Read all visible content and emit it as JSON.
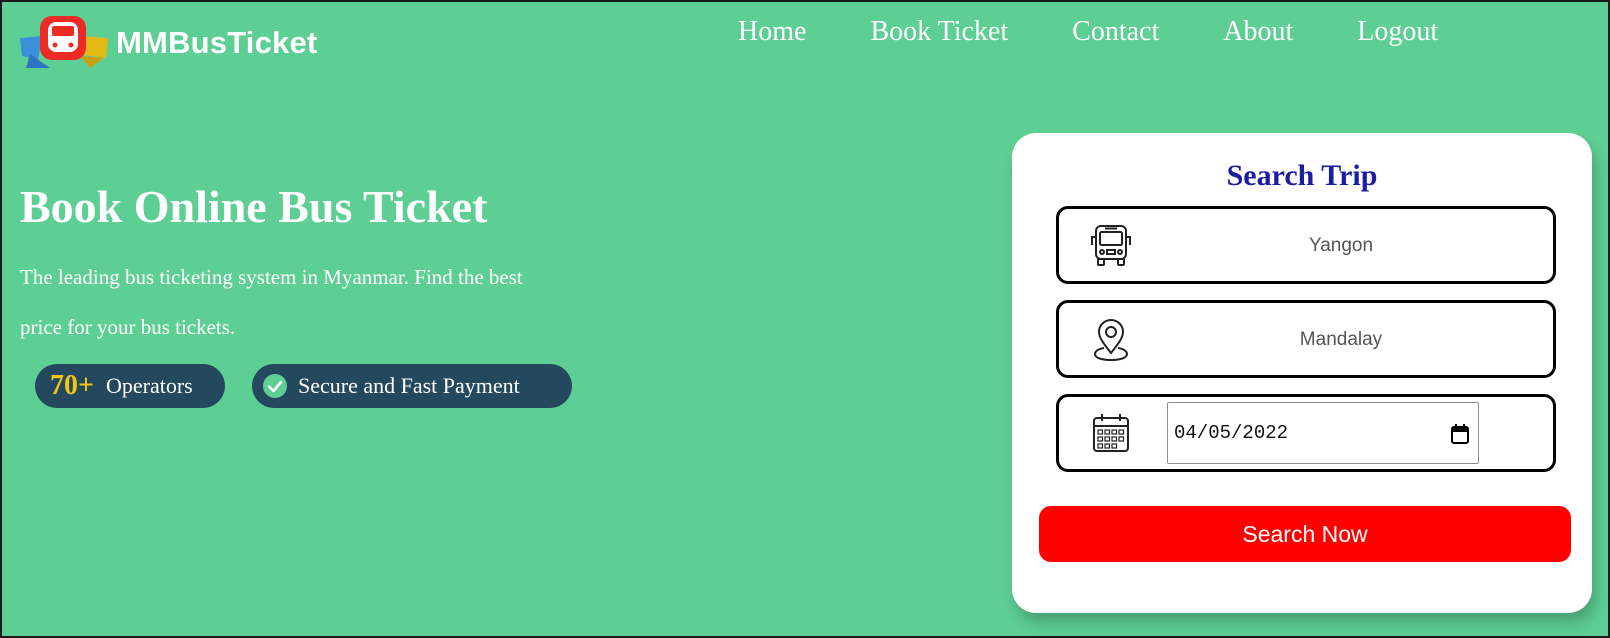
{
  "brand": {
    "name": "MMBusTicket",
    "logo_icon": "bus-logo-icon",
    "logo_color": "#ee2a24"
  },
  "nav": {
    "items": [
      "Home",
      "Book Ticket",
      "Contact",
      "About",
      "Logout"
    ]
  },
  "hero": {
    "title": "Book Online Bus Ticket",
    "description": "The leading bus ticketing system in Myanmar. Find the best price for your bus tickets.",
    "badges": {
      "operators_count": "70+",
      "operators_label": "Operators",
      "payment_label": "Secure and Fast Payment",
      "payment_icon": "check-circle-icon"
    }
  },
  "search": {
    "title": "Search Trip",
    "from": {
      "value": "Yangon",
      "icon": "bus-icon"
    },
    "to": {
      "value": "Mandalay",
      "icon": "location-pin-icon"
    },
    "date": {
      "value": "04/05/2022",
      "icon": "calendar-icon",
      "picker_icon": "calendar-picker-icon"
    },
    "button_label": "Search Now"
  },
  "colors": {
    "background": "#5ecf94",
    "pill": "#24485d",
    "accent_yellow": "#f3c613",
    "title_blue": "#1c1ca0",
    "button_red": "#ff0000"
  }
}
